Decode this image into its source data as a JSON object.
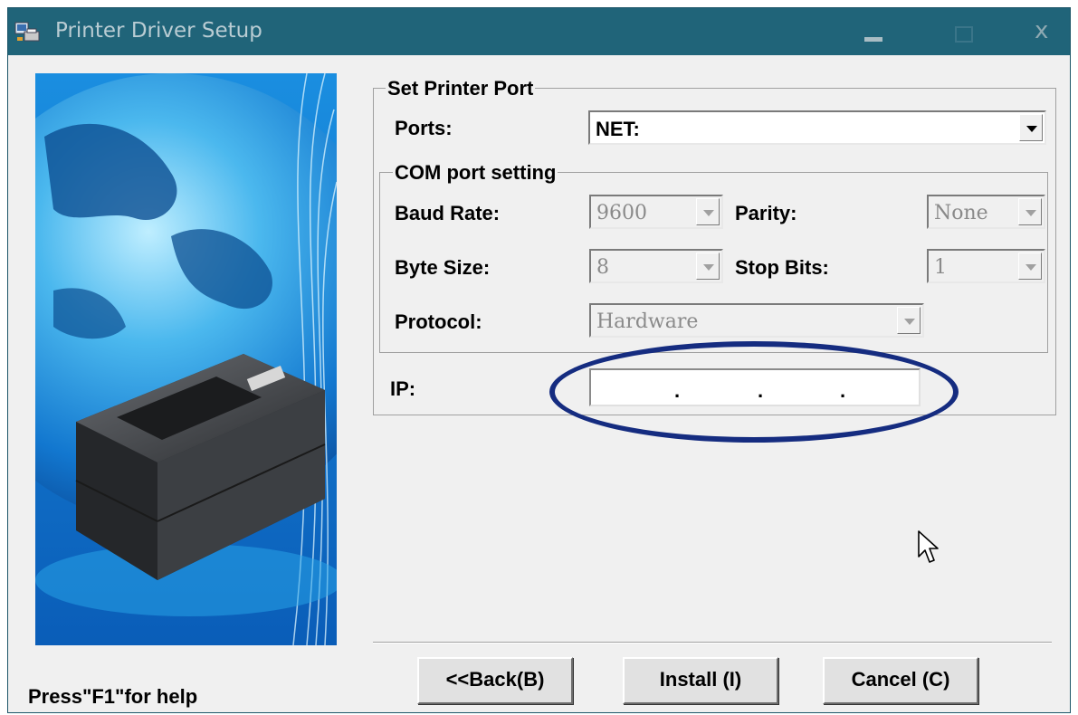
{
  "window": {
    "title": "Printer Driver Setup",
    "icon": "setup-app-icon",
    "controls": [
      "minimize-icon",
      "maximize-icon",
      "close-icon"
    ],
    "close_glyph": "x"
  },
  "port_group": {
    "label": "Set Printer Port",
    "ports_label": "Ports:",
    "ports_value": "NET:"
  },
  "com_group": {
    "label": "COM port setting",
    "baud_rate_label": "Baud Rate:",
    "baud_rate_value": "9600",
    "parity_label": "Parity:",
    "parity_value": "None",
    "byte_size_label": "Byte Size:",
    "byte_size_value": "8",
    "stop_bits_label": "Stop Bits:",
    "stop_bits_value": "1",
    "protocol_label": "Protocol:",
    "protocol_value": "Hardware"
  },
  "ip": {
    "label": "IP:",
    "separator": "."
  },
  "buttons": {
    "back": "<<Back(B)",
    "install": "Install (I)",
    "cancel": "Cancel (C)"
  },
  "status": {
    "help_text": "Press\"F1\"for help"
  },
  "colors": {
    "titlebar": "#206479",
    "highlight_ellipse": "#152c80",
    "window_bg": "#f0f0f0"
  }
}
